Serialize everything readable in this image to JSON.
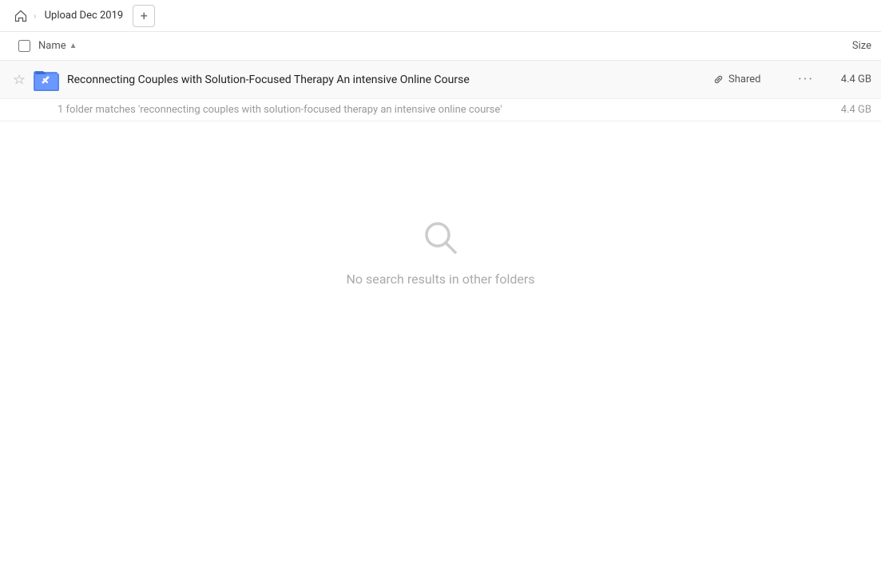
{
  "breadcrumb": {
    "home_label": "Home",
    "folder_name": "Upload Dec 2019",
    "add_button_label": "+"
  },
  "columns": {
    "name_label": "Name",
    "size_label": "Size"
  },
  "file_row": {
    "name": "Reconnecting Couples with Solution-Focused Therapy An intensive Online Course",
    "shared_label": "Shared",
    "size": "4.4 GB",
    "more_button": "···"
  },
  "match_summary": {
    "text": "1 folder matches 'reconnecting couples with solution-focused therapy an intensive online course'",
    "size": "4.4 GB"
  },
  "no_results": {
    "text": "No search results in other folders"
  }
}
